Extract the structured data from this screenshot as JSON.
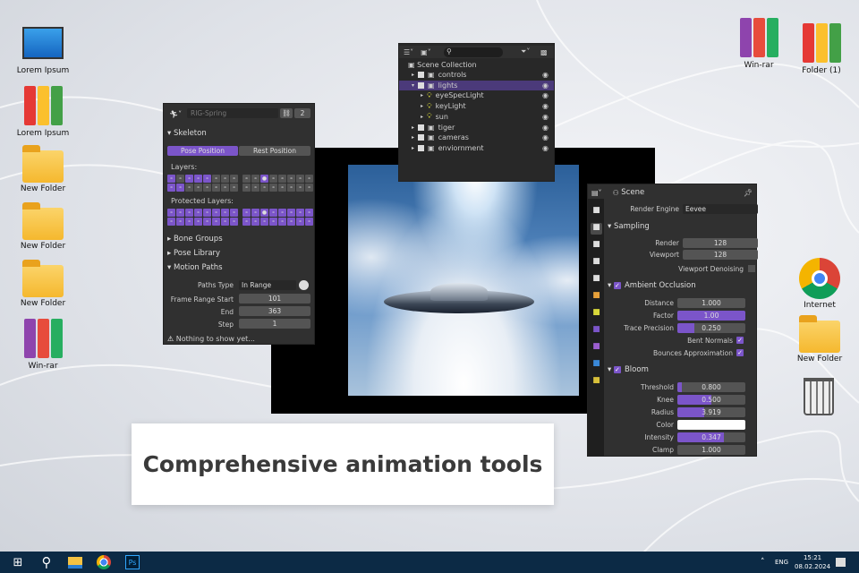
{
  "desktop": {
    "left_icons": [
      "Lorem Ipsum",
      "Lorem Ipsum",
      "New Folder",
      "New Folder",
      "New Folder",
      "Win-rar"
    ],
    "right_top": [
      "Win-rar",
      "Folder (1)"
    ],
    "right": [
      "Internet",
      "New Folder"
    ]
  },
  "skeleton": {
    "object_name": "RIG-Spring",
    "users": "2",
    "section": "Skeleton",
    "pose_position": "Pose Position",
    "rest_position": "Rest Position",
    "layers": "Layers:",
    "protected_layers": "Protected Layers:",
    "bone_groups": "Bone Groups",
    "pose_library": "Pose Library",
    "motion_paths": "Motion Paths",
    "paths_type_label": "Paths Type",
    "paths_type": "In Range",
    "frame_range_start_label": "Frame Range Start",
    "frame_range_start": "101",
    "end_label": "End",
    "end": "363",
    "step_label": "Step",
    "step": "1",
    "warning": "Nothing to show yet..."
  },
  "outliner": {
    "root": "Scene Collection",
    "items": [
      {
        "name": "controls",
        "level": 0,
        "type": "collection"
      },
      {
        "name": "lights",
        "level": 0,
        "type": "collection",
        "selected": true
      },
      {
        "name": "eyeSpecLight",
        "level": 1,
        "type": "light"
      },
      {
        "name": "keyLight",
        "level": 1,
        "type": "light"
      },
      {
        "name": "sun",
        "level": 1,
        "type": "light"
      },
      {
        "name": "tiger",
        "level": 0,
        "type": "collection"
      },
      {
        "name": "cameras",
        "level": 0,
        "type": "collection"
      },
      {
        "name": "enviornment",
        "level": 0,
        "type": "collection"
      }
    ]
  },
  "properties": {
    "title": "Scene",
    "render_engine_label": "Render Engine",
    "render_engine": "Eevee",
    "sampling": "Sampling",
    "render_label": "Render",
    "render": "128",
    "viewport_label": "Viewport",
    "viewport": "128",
    "denoise": "Viewport Denoising",
    "ao": "Ambient Occlusion",
    "distance_label": "Distance",
    "distance": "1.000",
    "factor_label": "Factor",
    "factor": "1.00",
    "factor_fill": 1.0,
    "trace_label": "Trace Precision",
    "trace": "0.250",
    "trace_fill": 0.25,
    "bent": "Bent Normals",
    "bounces": "Bounces Approximation",
    "bloom": "Bloom",
    "threshold_label": "Threshold",
    "threshold": "0.800",
    "threshold_fill": 0.06,
    "knee_label": "Knee",
    "knee": "0.500",
    "knee_fill": 0.5,
    "radius_label": "Radius",
    "radius": "3.919",
    "radius_fill": 0.39,
    "color_label": "Color",
    "intensity_label": "Intensity",
    "intensity": "0.347",
    "intensity_fill": 0.69,
    "clamp_label": "Clamp",
    "clamp": "1.000"
  },
  "caption": "Comprehensive animation tools",
  "taskbar": {
    "lang": "ENG",
    "time": "15:21",
    "date": "08.02.2024"
  },
  "colors": {
    "accent": "#7b55c9",
    "taskbar": "#0c2a45"
  }
}
